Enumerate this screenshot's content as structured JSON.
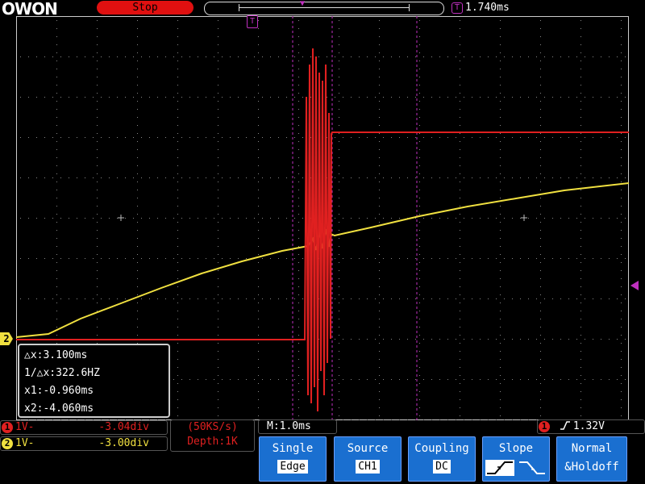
{
  "header": {
    "logo": "OWON",
    "run_status": "Stop",
    "trigger_position": "1.740ms"
  },
  "markers": {
    "trigger_marker": "T",
    "ch2_marker": "2"
  },
  "cursor_readout": {
    "delta_x": "△x:3.100ms",
    "inv_delta_x": "1/△x:322.6HZ",
    "x1": "x1:-0.960ms",
    "x2": "x2:-4.060ms"
  },
  "channels": [
    {
      "id": "1",
      "volts": "1V-",
      "offset": "-3.04div",
      "color": "#e02020"
    },
    {
      "id": "2",
      "volts": "1V-",
      "offset": "-3.00div",
      "color": "#f0e040"
    }
  ],
  "acquisition": {
    "sample_rate": "(50KS/s)",
    "depth": "Depth:1K"
  },
  "timebase": "M:1.0ms",
  "trigger_info": {
    "channel": "1",
    "level": "1.32V"
  },
  "menu": [
    {
      "title": "Single",
      "value": "Edge"
    },
    {
      "title": "Source",
      "value": "CH1"
    },
    {
      "title": "Coupling",
      "value": "DC"
    },
    {
      "title": "Slope",
      "value": "rising"
    },
    {
      "title": "Normal",
      "value": "&Holdoff"
    }
  ],
  "colors": {
    "ch1": "#e02020",
    "ch2": "#f0e040",
    "trigger": "#c030c0",
    "menu": "#1a6fd0"
  }
}
